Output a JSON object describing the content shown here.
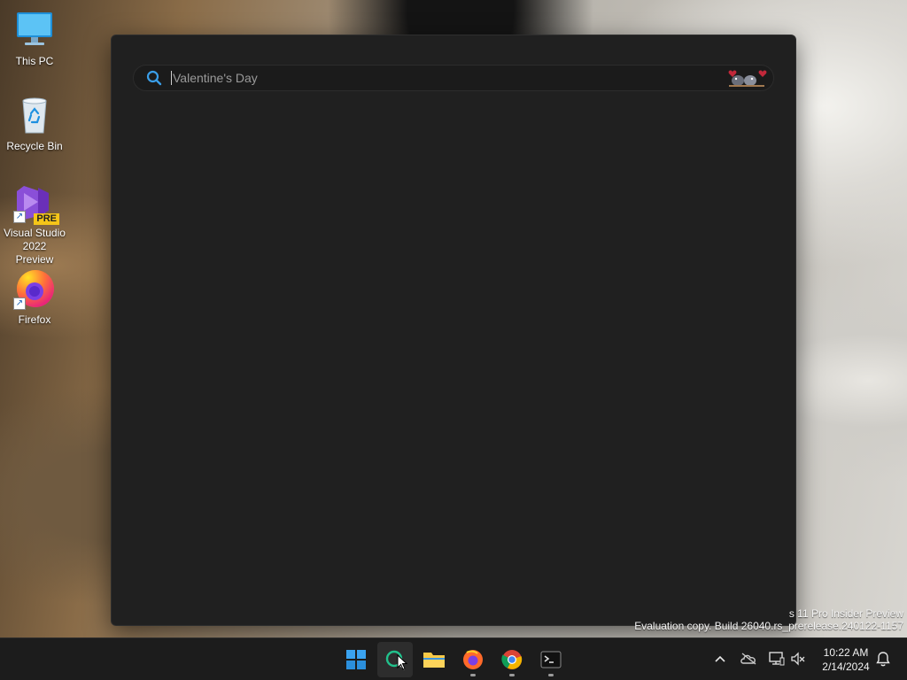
{
  "desktop": {
    "icons": [
      {
        "label": "This PC"
      },
      {
        "label": "Recycle Bin"
      },
      {
        "label": "Visual Studio 2022 Preview",
        "badge": "PRE"
      },
      {
        "label": "Firefox"
      }
    ]
  },
  "search": {
    "value": "Valentine's Day",
    "doodle": "valentine-birds-doodle-icon"
  },
  "watermark": {
    "line1": "s 11 Pro Insider Preview",
    "line2": "Evaluation copy. Build 26040.rs_prerelease.240122-1157"
  },
  "taskbar": {
    "apps": [
      "start-icon",
      "search-icon",
      "file-explorer-icon",
      "firefox-icon",
      "chrome-icon",
      "terminal-icon"
    ],
    "clock": {
      "time": "10:22 AM",
      "date": "2/14/2024"
    }
  },
  "colors": {
    "window_bg": "#202020",
    "taskbar_bg": "#1c1c1c",
    "accent": "#0078d4"
  }
}
